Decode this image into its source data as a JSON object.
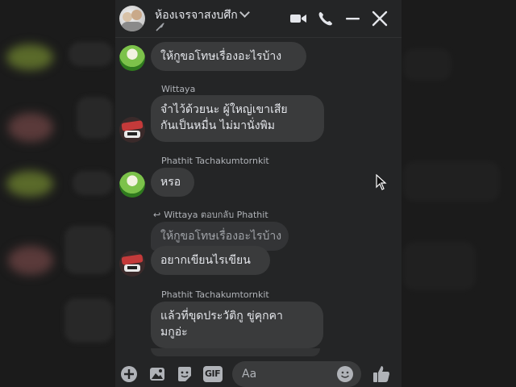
{
  "header": {
    "title": "ห้องเจรจาสงบศึก",
    "accent_color": "#a970ff"
  },
  "messages": [
    {
      "sender": "",
      "text_lines": [
        "ให้กูขอโทษเรื่องอะไรบ้าง"
      ]
    },
    {
      "sender": "Wittaya",
      "text_lines": [
        "จำไว้ด้วยนะ ผู้ใหญ่เขาเสีย",
        "กันเป็นหมื่น ไม่มานั่งพิม"
      ]
    },
    {
      "sender": "Phathit Tachakumtornkit",
      "text_lines": [
        "หรอ"
      ]
    },
    {
      "reply_label": "Wittaya ตอบกลับ Phathit",
      "quoted": "ให้กูขอโทษเรื่องอะไรบ้าง",
      "text_lines": [
        "อยากเขียนไรเขียน"
      ]
    },
    {
      "sender": "Phathit Tachakumtornkit",
      "text_lines": [
        "แล้วที่ขุดประวัติกู ขู่คุกคา",
        "มกูอ่ะ"
      ]
    }
  ],
  "composer": {
    "placeholder": "Aa",
    "icons": [
      "plus-icon",
      "image-icon",
      "sticker-icon",
      "gif-icon",
      "emoji-icon",
      "like-icon"
    ],
    "gif_label": "GIF",
    "like_color": "#ffffff"
  },
  "header_icons": [
    "video-call-icon",
    "phone-icon",
    "minimize-icon",
    "close-icon"
  ]
}
